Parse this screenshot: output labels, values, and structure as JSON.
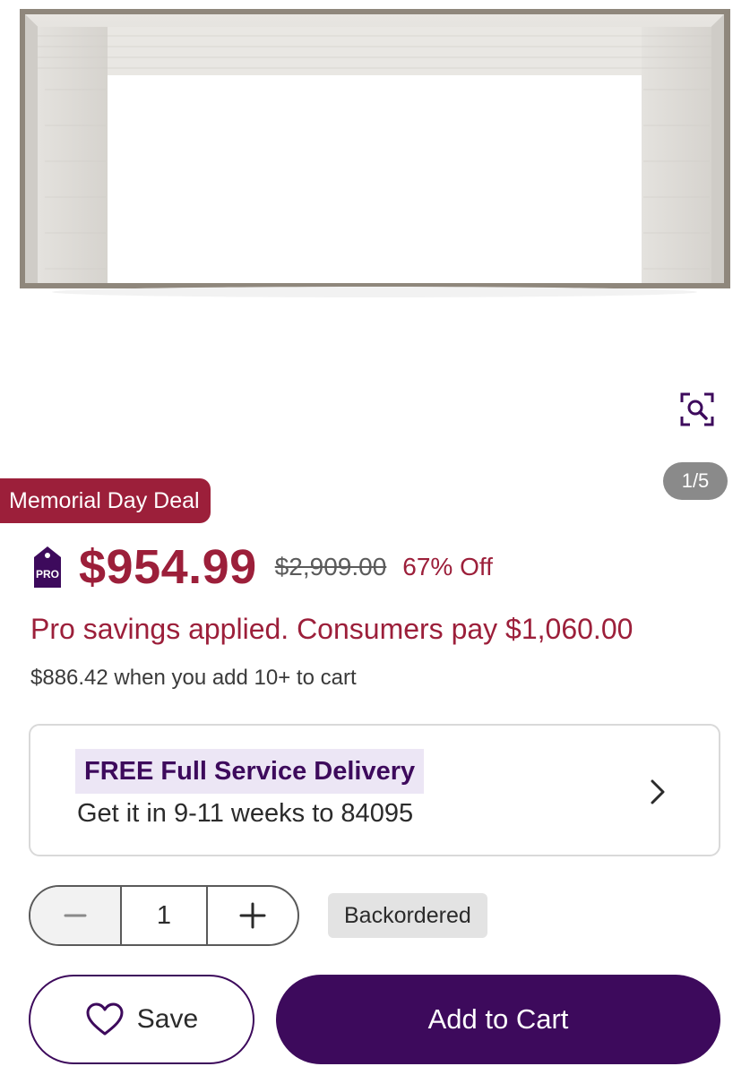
{
  "gallery": {
    "image_counter": "1/5"
  },
  "deal_badge": "Memorial Day Deal",
  "pricing": {
    "pro_badge_text": "PRO",
    "price": "$954.99",
    "was_price": "$2,909.00",
    "percent_off": "67% Off",
    "pro_savings_text": "Pro savings applied. Consumers pay $1,060.00",
    "bulk_price_text": "$886.42 when you add 10+ to cart"
  },
  "delivery": {
    "title": "FREE Full Service Delivery",
    "subtitle": "Get it in 9-11 weeks to 84095"
  },
  "quantity": {
    "value": "1"
  },
  "status": "Backordered",
  "actions": {
    "save_label": "Save",
    "add_to_cart_label": "Add to Cart"
  },
  "icons": {
    "zoom": "zoom-search-icon",
    "pro": "pro-tag-icon",
    "chevron": "chevron-right-icon",
    "minus": "minus-icon",
    "plus": "plus-icon",
    "heart": "heart-icon"
  },
  "colors": {
    "deal_red": "#9c1f3a",
    "brand_purple": "#3d0a5c",
    "delivery_highlight": "#ece6f5",
    "counter_gray": "#8a8a8a",
    "status_gray": "#e3e3e3"
  }
}
